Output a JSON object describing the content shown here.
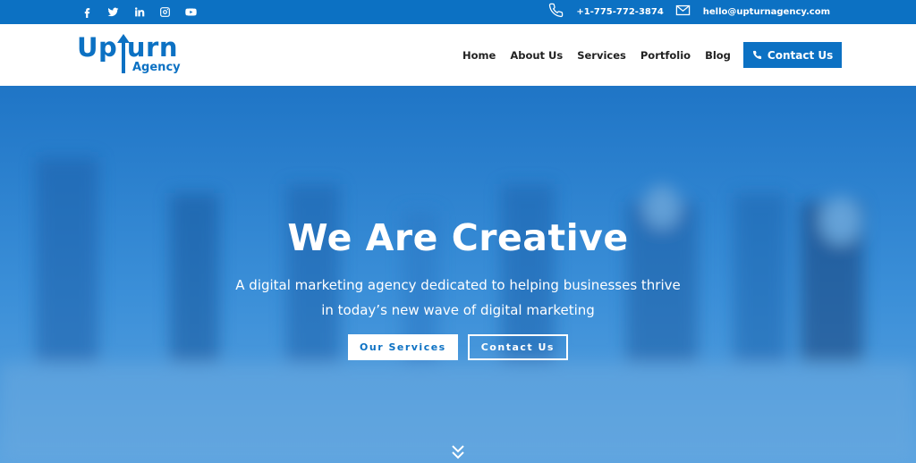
{
  "topbar": {
    "social": [
      {
        "icon": "facebook-icon"
      },
      {
        "icon": "twitter-icon"
      },
      {
        "icon": "linkedin-icon"
      },
      {
        "icon": "instagram-icon"
      },
      {
        "icon": "youtube-icon"
      }
    ],
    "phone_icon": "phone-icon",
    "phone": "+1-775-772-3874",
    "email_icon": "mail-icon",
    "email": "hello@upturnagency.com"
  },
  "header": {
    "logo": {
      "main": "Up  urn",
      "sub": "Agency"
    },
    "nav": [
      {
        "label": "Home"
      },
      {
        "label": "About Us"
      },
      {
        "label": "Services"
      },
      {
        "label": "Portfolio"
      },
      {
        "label": "Blog"
      }
    ],
    "cta": {
      "label": "Contact Us",
      "icon": "phone-icon"
    }
  },
  "hero": {
    "title": "We Are Creative",
    "subtitle_line1": "A digital marketing agency dedicated to helping businesses thrive",
    "subtitle_line2": "in today’s new wave of digital marketing",
    "primary_button": "Our Services",
    "secondary_button": "Contact Us",
    "scroll_icon": "chevron-double-down-icon"
  },
  "colors": {
    "brand_blue": "#0c71c3",
    "hero_blue": "#2f85d3",
    "white": "#ffffff",
    "nav_text": "#222222"
  }
}
